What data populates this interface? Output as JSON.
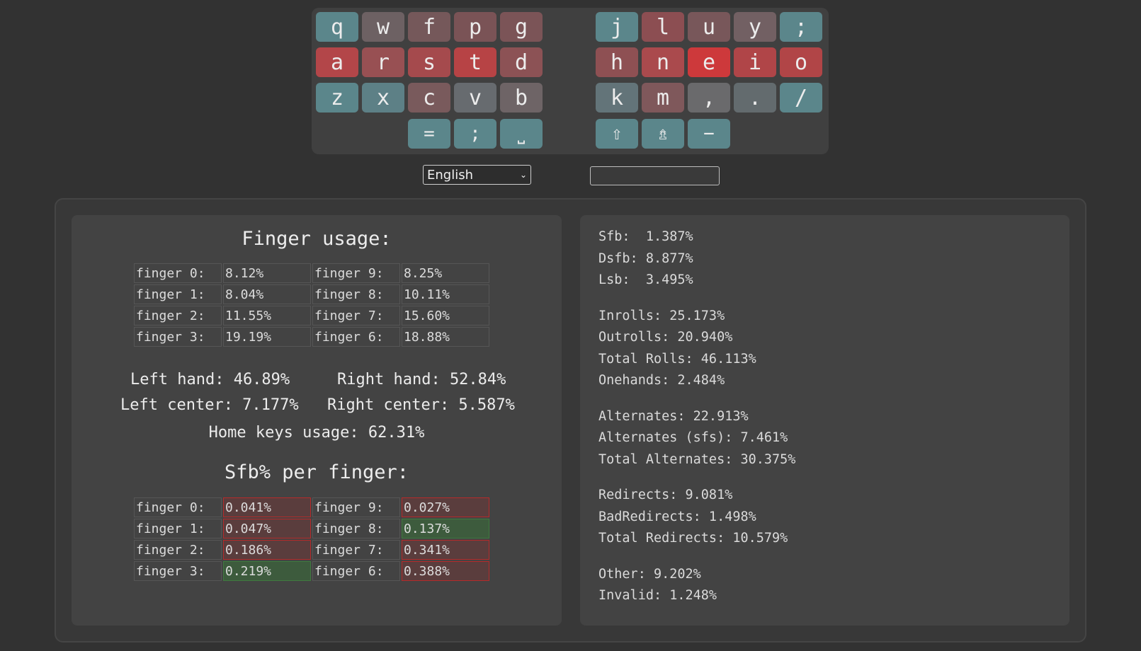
{
  "keyboard": {
    "keys": [
      {
        "label": "q",
        "color": "#5b868b",
        "row": 0,
        "col": 0
      },
      {
        "label": "w",
        "color": "#6d6163",
        "row": 0,
        "col": 1
      },
      {
        "label": "f",
        "color": "#75585a",
        "row": 0,
        "col": 2
      },
      {
        "label": "p",
        "color": "#7a5356",
        "row": 0,
        "col": 3
      },
      {
        "label": "g",
        "color": "#7b5457",
        "row": 0,
        "col": 4
      },
      {
        "label": "j",
        "color": "#5b868b",
        "row": 0,
        "col": 5
      },
      {
        "label": "l",
        "color": "#8c4e52",
        "row": 0,
        "col": 6
      },
      {
        "label": "u",
        "color": "#78575a",
        "row": 0,
        "col": 7
      },
      {
        "label": "y",
        "color": "#726063",
        "row": 0,
        "col": 8
      },
      {
        "label": ";",
        "color": "#5b868b",
        "row": 0,
        "col": 9
      },
      {
        "label": "a",
        "color": "#b34649",
        "row": 1,
        "col": 0
      },
      {
        "label": "r",
        "color": "#985053",
        "row": 1,
        "col": 1
      },
      {
        "label": "s",
        "color": "#a54a4d",
        "row": 1,
        "col": 2
      },
      {
        "label": "t",
        "color": "#b74345",
        "row": 1,
        "col": 3
      },
      {
        "label": "d",
        "color": "#8c5255",
        "row": 1,
        "col": 4
      },
      {
        "label": "h",
        "color": "#8e5053",
        "row": 1,
        "col": 5
      },
      {
        "label": "n",
        "color": "#aa4a4d",
        "row": 1,
        "col": 6
      },
      {
        "label": "e",
        "color": "#cd393b",
        "row": 1,
        "col": 7
      },
      {
        "label": "i",
        "color": "#b04548",
        "row": 1,
        "col": 8
      },
      {
        "label": "o",
        "color": "#b14547",
        "row": 1,
        "col": 9
      },
      {
        "label": "z",
        "color": "#5b868b",
        "row": 2,
        "col": 0
      },
      {
        "label": "x",
        "color": "#5d8086",
        "row": 2,
        "col": 1
      },
      {
        "label": "c",
        "color": "#795a5c",
        "row": 2,
        "col": 2
      },
      {
        "label": "v",
        "color": "#676b6f",
        "row": 2,
        "col": 3
      },
      {
        "label": "b",
        "color": "#6e6466",
        "row": 2,
        "col": 4
      },
      {
        "label": "k",
        "color": "#637479",
        "row": 2,
        "col": 5
      },
      {
        "label": "m",
        "color": "#7f585b",
        "row": 2,
        "col": 6
      },
      {
        "label": ",",
        "color": "#6a6a6c",
        "row": 2,
        "col": 7
      },
      {
        "label": ".",
        "color": "#636b6e",
        "row": 2,
        "col": 8
      },
      {
        "label": "/",
        "color": "#5b868b",
        "row": 2,
        "col": 9
      },
      {
        "label": "=",
        "color": "#5b868b",
        "row": 3,
        "col": 2
      },
      {
        "label": ";",
        "color": "#5b868b",
        "row": 3,
        "col": 3
      },
      {
        "label": "⎵",
        "color": "#5b868b",
        "row": 3,
        "col": 4
      },
      {
        "label": "⇧",
        "color": "#5b868b",
        "row": 3,
        "col": 5
      },
      {
        "label": "⇯",
        "color": "#5b868b",
        "row": 3,
        "col": 6
      },
      {
        "label": "−",
        "color": "#5b868b",
        "row": 3,
        "col": 7
      }
    ]
  },
  "controls": {
    "language": "English",
    "layout_input_value": ""
  },
  "finger_usage": {
    "title": "Finger usage:",
    "rows": [
      [
        "finger 0:",
        "8.12%",
        "finger 9:",
        "8.25%"
      ],
      [
        "finger 1:",
        "8.04%",
        "finger 8:",
        "10.11%"
      ],
      [
        "finger 2:",
        "11.55%",
        "finger 7:",
        "15.60%"
      ],
      [
        "finger 3:",
        "19.19%",
        "finger 6:",
        "18.88%"
      ]
    ],
    "left_hand": "Left hand: 46.89%",
    "right_hand": "Right hand: 52.84%",
    "left_center": "Left center: 7.177%",
    "right_center": "Right center: 5.587%",
    "home_keys": "Home keys usage: 62.31%"
  },
  "sfb_per_finger": {
    "title": "Sfb% per finger:",
    "rows": [
      [
        "finger 0:",
        "0.041%",
        "finger 9:",
        "0.027%"
      ],
      [
        "finger 1:",
        "0.047%",
        "finger 8:",
        "0.137%"
      ],
      [
        "finger 2:",
        "0.186%",
        "finger 7:",
        "0.341%"
      ],
      [
        "finger 3:",
        "0.219%",
        "finger 6:",
        "0.388%"
      ]
    ],
    "status": [
      [
        "bad",
        "bad"
      ],
      [
        "bad",
        "good"
      ],
      [
        "bad",
        "bad"
      ],
      [
        "good",
        "bad"
      ]
    ]
  },
  "metrics": [
    [
      "Sfb:  1.387%",
      "Dsfb: 8.877%",
      "Lsb:  3.495%"
    ],
    [
      "Inrolls: 25.173%",
      "Outrolls: 20.940%",
      "Total Rolls: 46.113%",
      "Onehands: 2.484%"
    ],
    [
      "Alternates: 22.913%",
      "Alternates (sfs): 7.461%",
      "Total Alternates: 30.375%"
    ],
    [
      "Redirects: 9.081%",
      "BadRedirects: 1.498%",
      "Total Redirects: 10.579%"
    ],
    [
      "Other: 9.202%",
      "Invalid: 1.248%"
    ]
  ]
}
